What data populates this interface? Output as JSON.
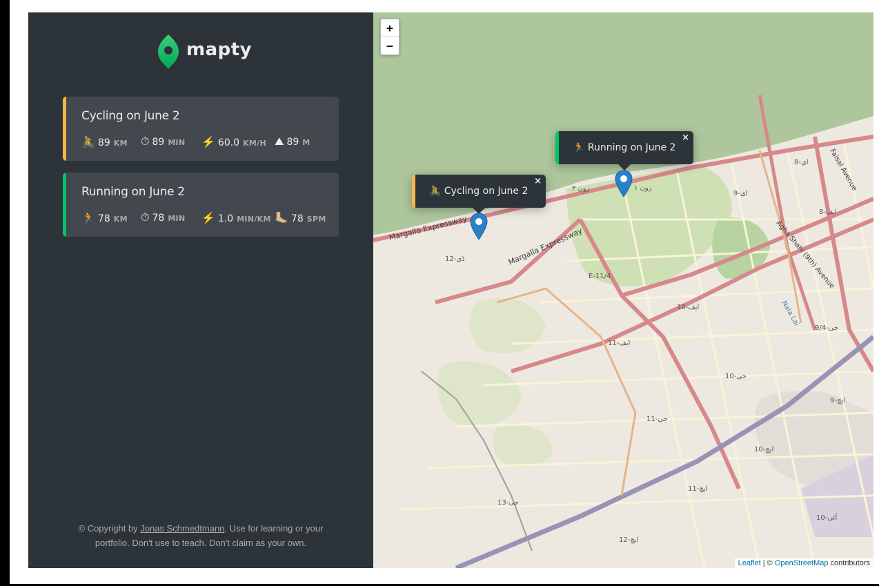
{
  "app": {
    "name": "mapty"
  },
  "workouts": [
    {
      "type": "cycling",
      "title": "Cycling on June 2",
      "details": [
        {
          "icon": "🚴",
          "value": "89",
          "unit": "KM"
        },
        {
          "icon": "⏱",
          "value": "89",
          "unit": "MIN"
        },
        {
          "icon": "⚡️",
          "value": "60.0",
          "unit": "KM/H"
        },
        {
          "icon": "⛰",
          "value": "89",
          "unit": "M"
        }
      ],
      "color": "#ffb545"
    },
    {
      "type": "running",
      "title": "Running on June 2",
      "details": [
        {
          "icon": "🏃",
          "value": "78",
          "unit": "KM"
        },
        {
          "icon": "⏱",
          "value": "78",
          "unit": "MIN"
        },
        {
          "icon": "⚡️",
          "value": "1.0",
          "unit": "MIN/KM"
        },
        {
          "icon": "🦶🏼",
          "value": "78",
          "unit": "SPM"
        }
      ],
      "color": "#00c46a"
    }
  ],
  "footer": {
    "prefix": "© Copyright by ",
    "author": "Jonas Schmedtmann",
    "suffix": ". Use for learning or your portfolio. Don't use to teach. Don't claim as your own."
  },
  "map": {
    "zoom_in": "+",
    "zoom_out": "−",
    "popups": {
      "running": {
        "icon": "🏃",
        "text": "Running on June 2",
        "close": "×"
      },
      "cycling": {
        "icon": "🚴",
        "text": "Cycling on June 2",
        "close": "×"
      }
    },
    "attribution": {
      "leaflet": "Leaflet",
      "separator": " | © ",
      "osm": "OpenStreetMap",
      "suffix": " contributors"
    },
    "labels": [
      "Margalla Expressway",
      "Margalla Expressway",
      "Faisal Avenue",
      "Agha Shahi (9th) Avenue",
      "E-11/4",
      "Nala Lai",
      "9/4-جی",
      "10-ایف",
      "11-ایف",
      "10-جی",
      "11-جی",
      "13-جی",
      "9-ایچ",
      "10-ایچ",
      "11-ایچ",
      "12-ایچ",
      "10-آئی",
      "8-ای",
      "9-ای",
      "8-ایف",
      "زون ۳",
      "زون ۱",
      "ڈی-12"
    ]
  },
  "colors": {
    "sidebar": "#2d3439",
    "card": "#42484d",
    "cycling": "#ffb545",
    "running": "#00c46a",
    "brand_green": "#00c46a"
  }
}
